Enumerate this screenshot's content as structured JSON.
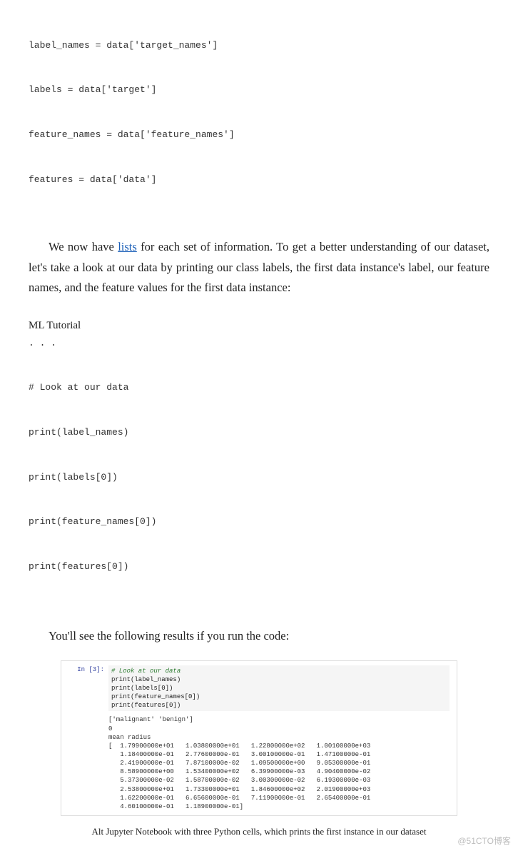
{
  "code_block_1": {
    "lines": [
      "label_names = data['target_names']",
      "labels = data['target']",
      "feature_names = data['feature_names']",
      "features = data['data']"
    ]
  },
  "para1": {
    "seg1": "We  now  have ",
    "link": "lists",
    "seg2": "  for  each  set  of  information.  To  get  a  better understanding of our dataset, let's take a look at our data by printing our class  labels, the  first  data  instance's  label,  our  feature  names,  and  the feature values for the first data instance:"
  },
  "ml_heading": "ML Tutorial",
  "ellipsis": ". . .",
  "code_block_2": {
    "comment": "# Look at our data",
    "lines": [
      "print(label_names)",
      "print(labels[0])",
      "print(feature_names[0])",
      "print(features[0])"
    ]
  },
  "para2": "You'll see the following results if you run the code:",
  "jupyter": {
    "prompt": "In [3]:",
    "code": {
      "comment": "# Look at our data",
      "lines": [
        "print(label_names)",
        "print(labels[0])",
        "print(feature_names[0])",
        "print(features[0])"
      ]
    },
    "output_lines": [
      "['malignant' 'benign']",
      "0",
      "mean radius",
      "[  1.79900000e+01   1.03800000e+01   1.22800000e+02   1.00100000e+03",
      "   1.18400000e-01   2.77600000e-01   3.00100000e-01   1.47100000e-01",
      "   2.41900000e-01   7.87100000e-02   1.09500000e+00   9.05300000e-01",
      "   8.58900000e+00   1.53400000e+02   6.39900000e-03   4.90400000e-02",
      "   5.37300000e-02   1.58700000e-02   3.00300000e-02   6.19300000e-03",
      "   2.53800000e+01   1.73300000e+01   1.84600000e+02   2.01900000e+03",
      "   1.62200000e-01   6.65600000e-01   7.11900000e-01   2.65400000e-01",
      "   4.60100000e-01   1.18900000e-01]"
    ]
  },
  "caption": "Alt Jupyter Notebook with three Python cells, which prints the first instance in our dataset",
  "watermark": "@51CTO博客"
}
